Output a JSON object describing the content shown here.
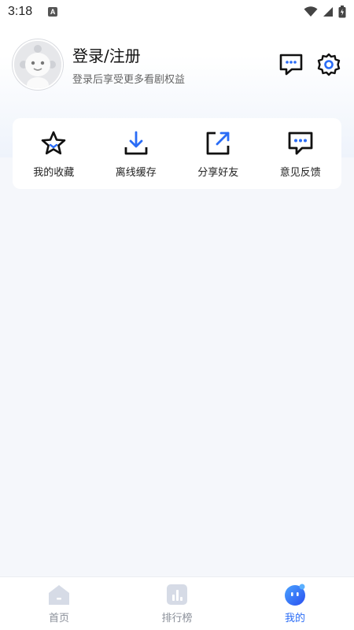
{
  "status": {
    "time": "3:18",
    "notif": "A"
  },
  "profile": {
    "title": "登录/注册",
    "subtitle": "登录后享受更多看剧权益"
  },
  "quick_actions": [
    {
      "label": "我的收藏",
      "icon": "star-icon"
    },
    {
      "label": "离线缓存",
      "icon": "download-icon"
    },
    {
      "label": "分享好友",
      "icon": "share-icon"
    },
    {
      "label": "意见反馈",
      "icon": "feedback-icon"
    }
  ],
  "tabs": [
    {
      "label": "首页",
      "icon": "home-icon",
      "active": false
    },
    {
      "label": "排行榜",
      "icon": "chart-icon",
      "active": false
    },
    {
      "label": "我的",
      "icon": "profile-icon",
      "active": true
    }
  ],
  "colors": {
    "accent": "#2a6cf6",
    "muted": "#8a8f99"
  }
}
